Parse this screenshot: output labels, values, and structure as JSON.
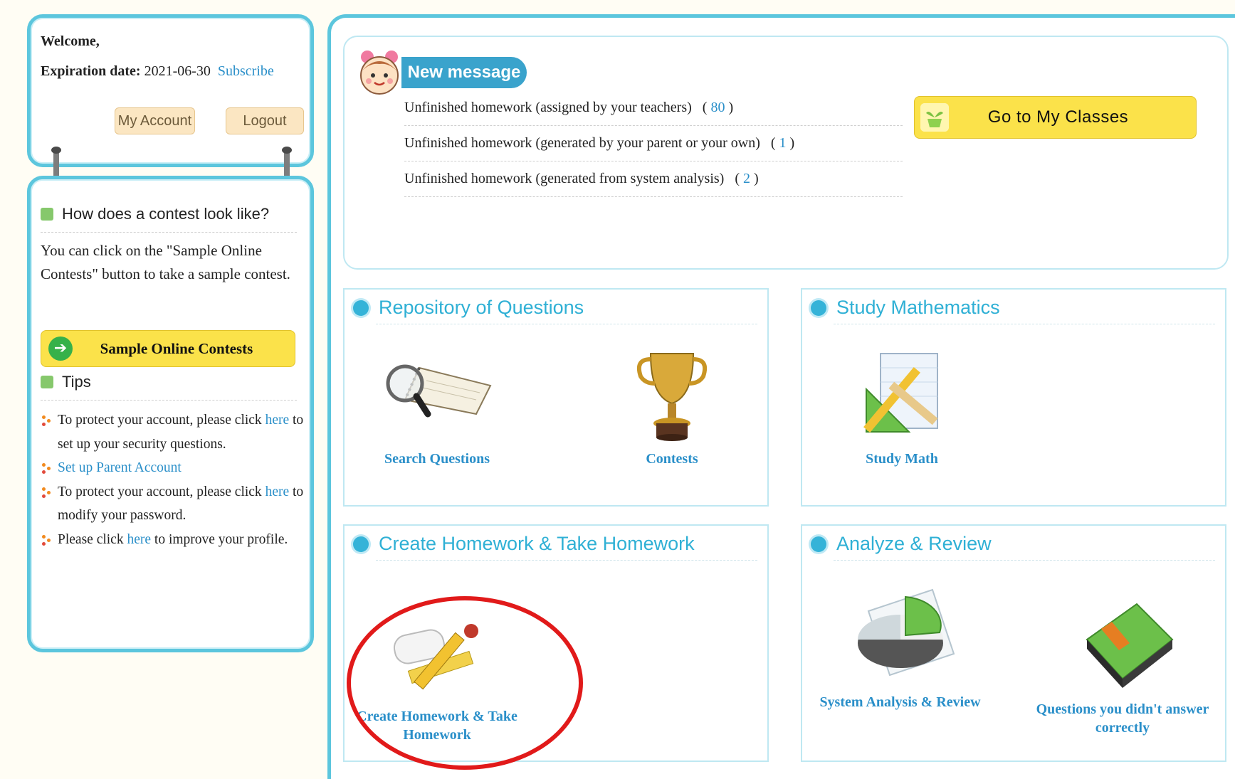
{
  "account": {
    "welcome": "Welcome,",
    "expiration_label": "Expiration date:",
    "expiration_value": "2021-06-30",
    "subscribe": "Subscribe",
    "my_account": "My Account",
    "logout": "Logout"
  },
  "contest_info": {
    "heading": "How does a contest look like?",
    "body": "You can click on the \"Sample Online Contests\" button to take a sample contest.",
    "button": "Sample Online Contests"
  },
  "tips": {
    "heading": "Tips",
    "t1_pre": "To protect your account, please click",
    "t1_link": "here",
    "t1_post": "to set up your security questions.",
    "t2_link": "Set up Parent Account",
    "t3_pre": "To protect your account, please click",
    "t3_link": "here",
    "t3_post": "to modify your password.",
    "t4_pre": "Please click",
    "t4_link": "here",
    "t4_post": "to improve your profile."
  },
  "messages": {
    "badge": "New message",
    "rows": [
      {
        "label": "Unfinished homework (assigned by your teachers)",
        "count": "80"
      },
      {
        "label": "Unfinished homework (generated by your parent or your own)",
        "count": "1"
      },
      {
        "label": "Unfinished homework (generated from system analysis)",
        "count": "2"
      }
    ],
    "go_classes": "Go to My Classes"
  },
  "cards": {
    "repo": {
      "title": "Repository of Questions",
      "item1": "Search Questions",
      "item2": "Contests"
    },
    "study": {
      "title": "Study Mathematics",
      "item1": "Study Math"
    },
    "homework": {
      "title": "Create Homework & Take Homework",
      "item1": "Create Homework & Take Homework"
    },
    "analyze": {
      "title": "Analyze & Review",
      "item1": "System Analysis & Review",
      "item2": "Questions you didn't answer correctly"
    }
  },
  "icons": {
    "girl": "cartoon-girl-icon",
    "pot": "plant-pot-icon",
    "arrow": "arrow-right-icon",
    "search": "magnifier-notebook-icon",
    "trophy": "trophy-icon",
    "math": "ruler-pencil-icon",
    "homework": "scroll-pencil-icon",
    "analysis": "pie-chart-icon",
    "book": "green-book-icon"
  },
  "colors": {
    "frame": "#5cc6dd",
    "title_blue": "#2fb0d5",
    "link_blue": "#2a8fc9",
    "button_yellow": "#fbe24a",
    "highlight_red": "#e11a1a"
  }
}
